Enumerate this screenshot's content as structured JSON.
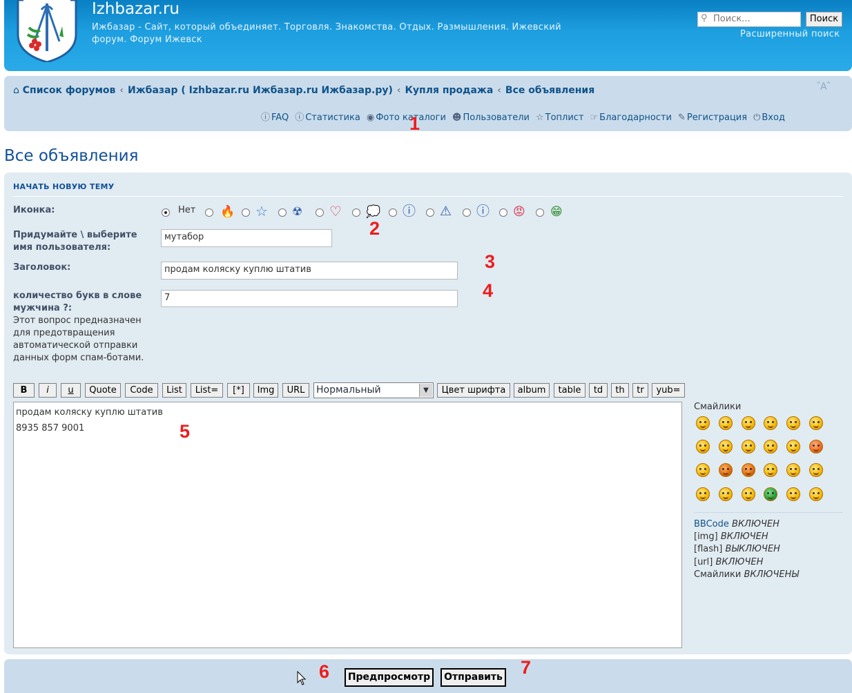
{
  "header": {
    "site_title": "Izhbazar.ru",
    "site_description": "Ижбазар - Сайт, который объединяет. Торговля. Знакомства. Отдых. Размышления. Ижевский форум. Форум Ижевск",
    "search_placeholder": "Поиск...",
    "search_button": "Поиск",
    "advanced_search": "Расширенный поиск"
  },
  "navbar": {
    "breadcrumbs": [
      "Список форумов",
      "Ижбазар ( Izhbazar.ru Ижбазар.ru Ижбазар.ру)",
      "Купля продажа",
      "Все объявления"
    ],
    "separator": "‹",
    "font_size_control": "ˇAˆ",
    "links": [
      "FAQ",
      "Статистика",
      "Фото каталоги",
      "Пользователи",
      "Топлист",
      "Благодарности",
      "Регистрация",
      "Вход"
    ]
  },
  "page": {
    "title": "Все объявления"
  },
  "form": {
    "heading": "НАЧАТЬ НОВУЮ ТЕМУ",
    "icon_label": "Иконка:",
    "icon_none": "Нет",
    "username_label": "Придумайте \\ выберите имя пользователя:",
    "username_value": "мутабор",
    "subject_label": "Заголовок:",
    "subject_value": "продам коляску куплю штатив",
    "question_label": "количество букв в слове мужчина ?:",
    "question_explain": "Этот вопрос предназначен для предотвращения автоматической отправки данных форм спам-ботами.",
    "question_value": "7",
    "toolbar": [
      "B",
      "i",
      "u",
      "Quote",
      "Code",
      "List",
      "List=",
      "[*]",
      "Img",
      "URL"
    ],
    "font_size_selected": "Нормальный",
    "toolbar_right": [
      "Цвет шрифта",
      "album",
      "table",
      "td",
      "th",
      "tr",
      "yub="
    ],
    "message": "продам коляску куплю штатив\n8935 857 9001",
    "smilies_title": "Смайлики",
    "options": [
      {
        "name": "BBCode",
        "state": "ВКЛЮЧЕН"
      },
      {
        "name": "[img]",
        "state": "ВКЛЮЧЕН"
      },
      {
        "name": "[flash]",
        "state": "ВЫКЛЮЧЕН"
      },
      {
        "name": "[url]",
        "state": "ВКЛЮЧЕН"
      },
      {
        "name": "Смайлики",
        "state": "ВКЛЮЧЕНЫ"
      }
    ],
    "preview_button": "Предпросмотр",
    "submit_button": "Отправить"
  },
  "annotations": [
    "1",
    "2",
    "3",
    "4",
    "5",
    "6",
    "7"
  ],
  "colors": {
    "header_blue": "#1d9fe0",
    "nav_bg": "#cadceb",
    "panel_bg": "#e1ebf2",
    "link": "#105289",
    "annotation_red": "#ee1c1c"
  }
}
